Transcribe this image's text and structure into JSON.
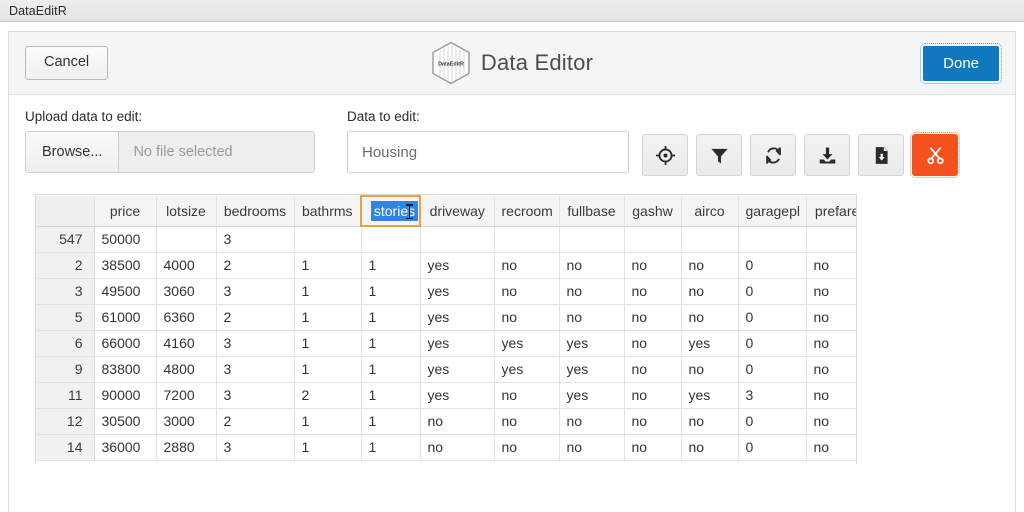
{
  "window": {
    "title": "DataEditR"
  },
  "header": {
    "cancel_label": "Cancel",
    "app_title": "Data Editor",
    "logo_text": "DataEditR",
    "done_label": "Done",
    "done_color": "#1178be"
  },
  "controls": {
    "upload_label": "Upload data to edit:",
    "browse_label": "Browse...",
    "file_placeholder": "No file selected",
    "data_label": "Data to edit:",
    "data_value": "Housing",
    "icons": [
      {
        "name": "crosshairs-icon",
        "title": "Select"
      },
      {
        "name": "filter-icon",
        "title": "Filter"
      },
      {
        "name": "sync-icon",
        "title": "Refresh"
      },
      {
        "name": "download-icon",
        "title": "Download"
      },
      {
        "name": "file-save-icon",
        "title": "Save file"
      },
      {
        "name": "scissors-icon",
        "title": "Cut",
        "color": "#f4511e"
      }
    ]
  },
  "table": {
    "selected_column": "stories",
    "selection_fill": "#2e86de",
    "selection_border": "#e8a33d",
    "columns": [
      "price",
      "lotsize",
      "bedrooms",
      "bathrms",
      "stories",
      "driveway",
      "recroom",
      "fullbase",
      "gashw",
      "airco",
      "garagepl",
      "prefarea"
    ],
    "rows": [
      {
        "index": "547",
        "cells": [
          "50000",
          "",
          "3",
          "",
          "",
          "",
          "",
          "",
          "",
          "",
          "",
          ""
        ]
      },
      {
        "index": "2",
        "cells": [
          "38500",
          "4000",
          "2",
          "1",
          "1",
          "yes",
          "no",
          "no",
          "no",
          "no",
          "0",
          "no"
        ]
      },
      {
        "index": "3",
        "cells": [
          "49500",
          "3060",
          "3",
          "1",
          "1",
          "yes",
          "no",
          "no",
          "no",
          "no",
          "0",
          "no"
        ]
      },
      {
        "index": "5",
        "cells": [
          "61000",
          "6360",
          "2",
          "1",
          "1",
          "yes",
          "no",
          "no",
          "no",
          "no",
          "0",
          "no"
        ]
      },
      {
        "index": "6",
        "cells": [
          "66000",
          "4160",
          "3",
          "1",
          "1",
          "yes",
          "yes",
          "yes",
          "no",
          "yes",
          "0",
          "no"
        ]
      },
      {
        "index": "9",
        "cells": [
          "83800",
          "4800",
          "3",
          "1",
          "1",
          "yes",
          "yes",
          "yes",
          "no",
          "no",
          "0",
          "no"
        ]
      },
      {
        "index": "11",
        "cells": [
          "90000",
          "7200",
          "3",
          "2",
          "1",
          "yes",
          "no",
          "yes",
          "no",
          "yes",
          "3",
          "no"
        ]
      },
      {
        "index": "12",
        "cells": [
          "30500",
          "3000",
          "2",
          "1",
          "1",
          "no",
          "no",
          "no",
          "no",
          "no",
          "0",
          "no"
        ]
      },
      {
        "index": "14",
        "cells": [
          "36000",
          "2880",
          "3",
          "1",
          "1",
          "no",
          "no",
          "no",
          "no",
          "no",
          "0",
          "no"
        ]
      }
    ]
  }
}
